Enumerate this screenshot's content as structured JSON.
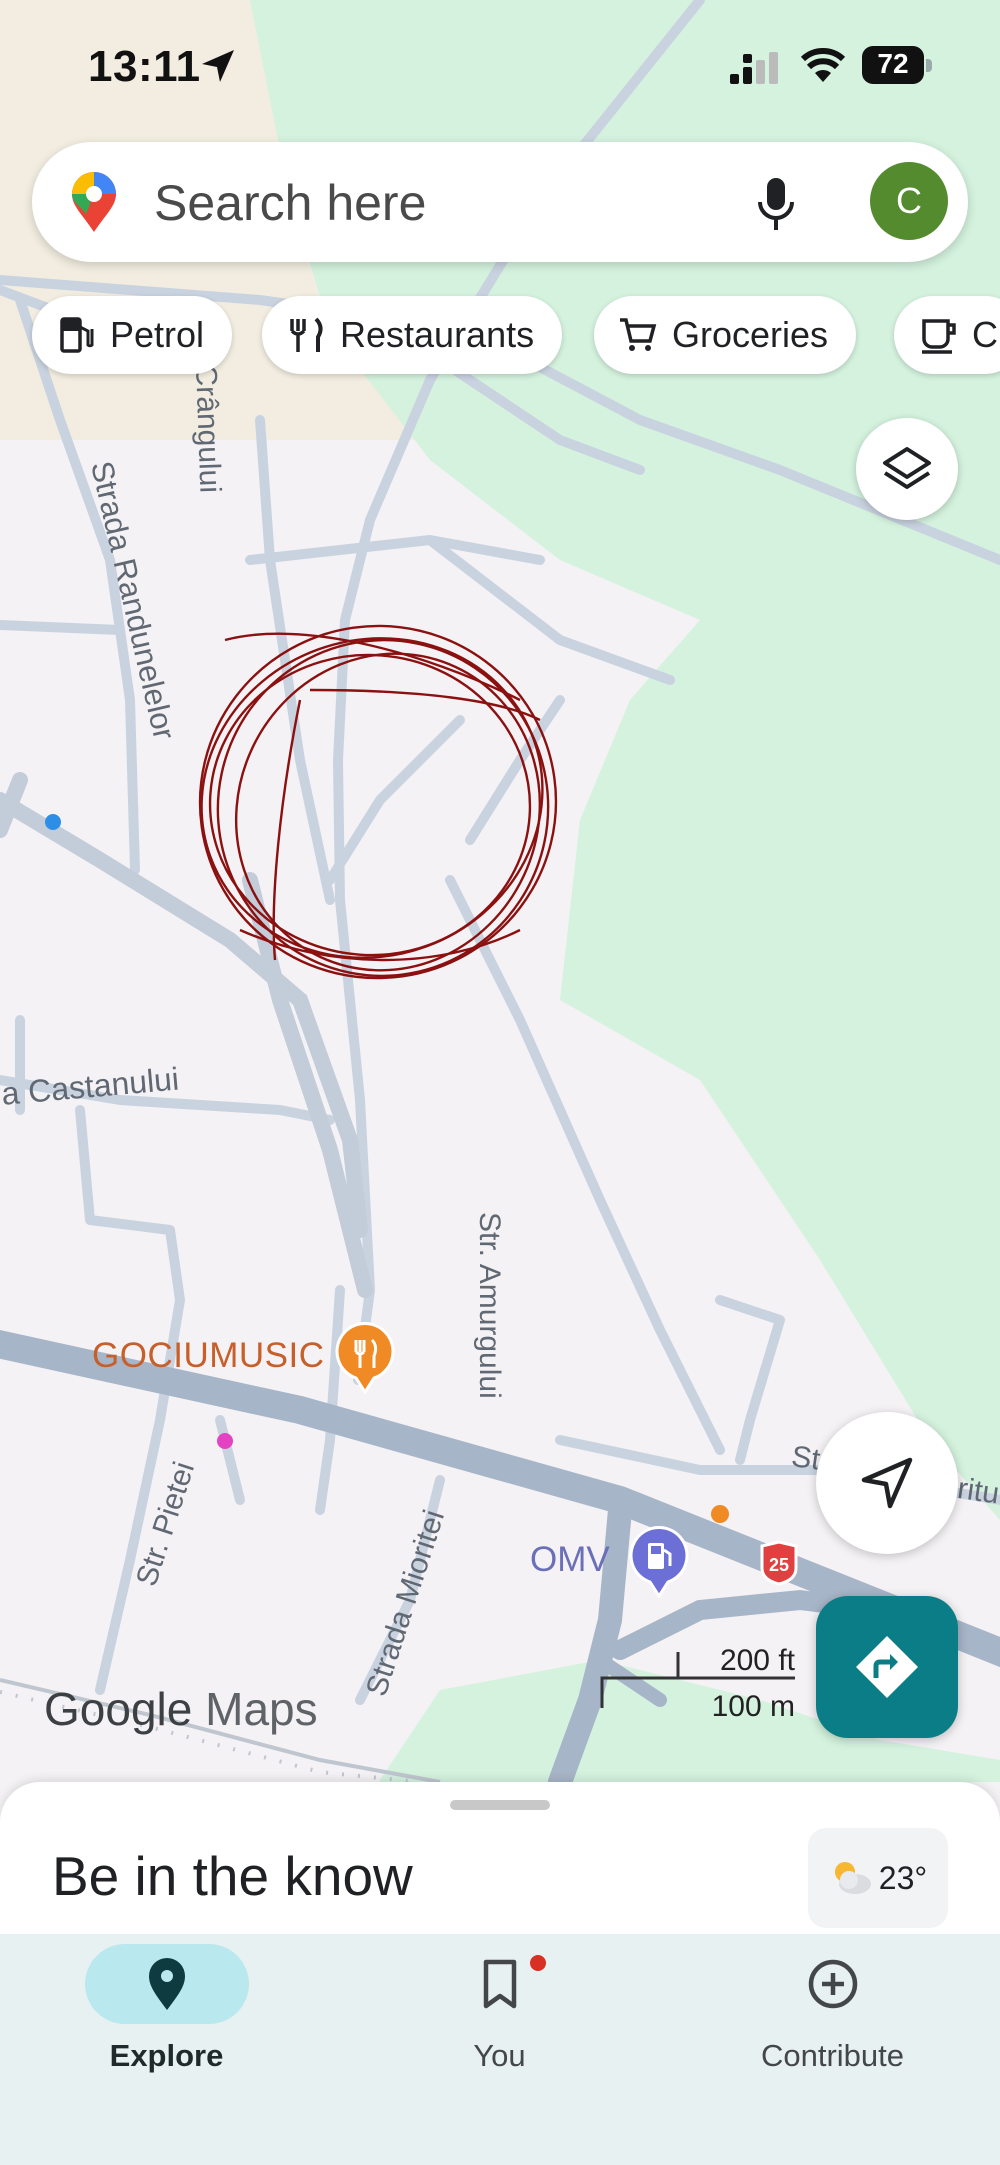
{
  "status_bar": {
    "time": "13:11",
    "battery": "72",
    "icons": [
      "location-arrow-icon",
      "signal-icon",
      "wifi-icon",
      "battery-icon"
    ]
  },
  "search": {
    "placeholder": "Search here",
    "avatar_letter": "C"
  },
  "chips": [
    {
      "label": "Petrol",
      "icon": "fuel-icon"
    },
    {
      "label": "Restaurants",
      "icon": "fork-knife-icon"
    },
    {
      "label": "Groceries",
      "icon": "cart-icon"
    },
    {
      "label": "C",
      "icon": "coffee-icon"
    }
  ],
  "map": {
    "streets": [
      "Strada Randunelelor",
      "Crângului",
      "a Castanului",
      "Str. Amurgului",
      "Str. Pietei",
      "Strada Mioritei",
      "St",
      "ritu"
    ],
    "pois": [
      {
        "name": "GOCIUMUSIC",
        "type": "restaurant"
      },
      {
        "name": "OMV",
        "type": "petrol"
      }
    ],
    "route_shield": "25",
    "scale": {
      "imperial": "200 ft",
      "metric": "100 m"
    },
    "logo": {
      "google": "Google",
      "maps": "Maps"
    }
  },
  "sheet": {
    "title": "Be in the know",
    "temperature": "23°",
    "weather_icon": "partly-cloudy-icon"
  },
  "bottom_nav": [
    {
      "label": "Explore",
      "icon": "location-pin-icon",
      "active": true
    },
    {
      "label": "You",
      "icon": "bookmark-icon",
      "active": false,
      "badge": true
    },
    {
      "label": "Contribute",
      "icon": "add-circle-icon",
      "active": false
    }
  ],
  "colors": {
    "park": "#d4f2de",
    "road": "#c9d3e0",
    "main_road": "#a7b5c8",
    "accent": "#0b7d86",
    "scribble": "#8b1010"
  }
}
